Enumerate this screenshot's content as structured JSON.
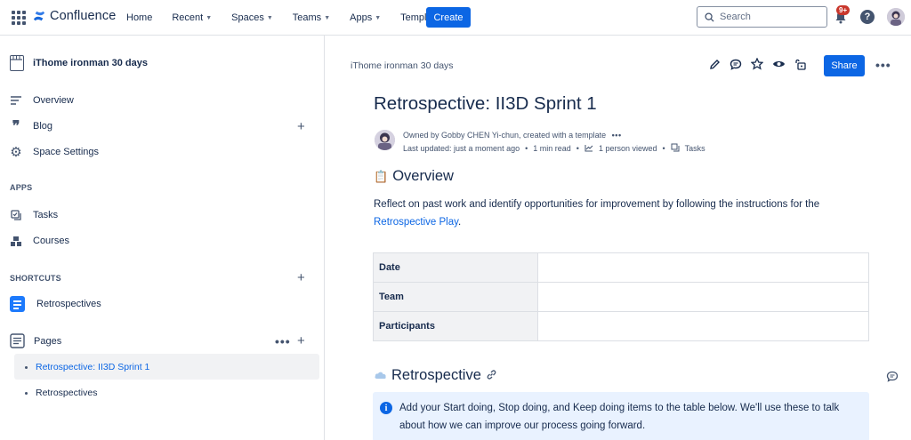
{
  "topnav": {
    "product": "Confluence",
    "items": [
      {
        "label": "Home",
        "dropdown": false
      },
      {
        "label": "Recent",
        "dropdown": true
      },
      {
        "label": "Spaces",
        "dropdown": true
      },
      {
        "label": "Teams",
        "dropdown": true
      },
      {
        "label": "Apps",
        "dropdown": true
      },
      {
        "label": "Templates",
        "dropdown": false
      }
    ],
    "create_label": "Create",
    "search_placeholder": "Search",
    "notification_badge": "9+"
  },
  "sidebar": {
    "space_name": "iThome ironman 30 days",
    "nav": [
      {
        "label": "Overview",
        "icon": "overview-icon"
      },
      {
        "label": "Blog",
        "icon": "quote-icon"
      },
      {
        "label": "Space Settings",
        "icon": "gear-icon"
      }
    ],
    "apps_label": "APPS",
    "apps": [
      {
        "label": "Tasks",
        "icon": "tasks-icon"
      },
      {
        "label": "Courses",
        "icon": "courses-icon"
      }
    ],
    "shortcuts_label": "SHORTCUTS",
    "shortcuts": [
      {
        "label": "Retrospectives",
        "icon": "document-icon"
      }
    ],
    "pages_label": "Pages",
    "pages": [
      {
        "label": "Retrospective: II3D Sprint 1",
        "selected": true
      },
      {
        "label": "Retrospectives",
        "selected": false
      }
    ]
  },
  "page": {
    "breadcrumb": "iThome ironman 30 days",
    "share_label": "Share",
    "title": "Retrospective: II3D Sprint 1",
    "owner_line": "Owned by Gobby CHEN Yi-chun, created with a template",
    "meta": {
      "updated": "Last updated: just a moment ago",
      "read": "1 min read",
      "viewed": "1 person viewed",
      "tasks": "Tasks"
    },
    "overview_heading": "Overview",
    "overview_text": "Reflect on past work and identify opportunities for improvement by following the instructions for the ",
    "overview_link": "Retrospective Play",
    "overview_end": ".",
    "table": [
      {
        "label": "Date",
        "value": ""
      },
      {
        "label": "Team",
        "value": ""
      },
      {
        "label": "Participants",
        "value": ""
      }
    ],
    "retro_heading": "Retrospective",
    "info_text": "Add your Start doing, Stop doing, and Keep doing items to the table below. We'll use these to talk about how we can improve our process going forward."
  },
  "colors": {
    "brand_blue": "#0c66e4",
    "badge_red": "#c9372c",
    "info_bg": "#e9f2ff"
  }
}
